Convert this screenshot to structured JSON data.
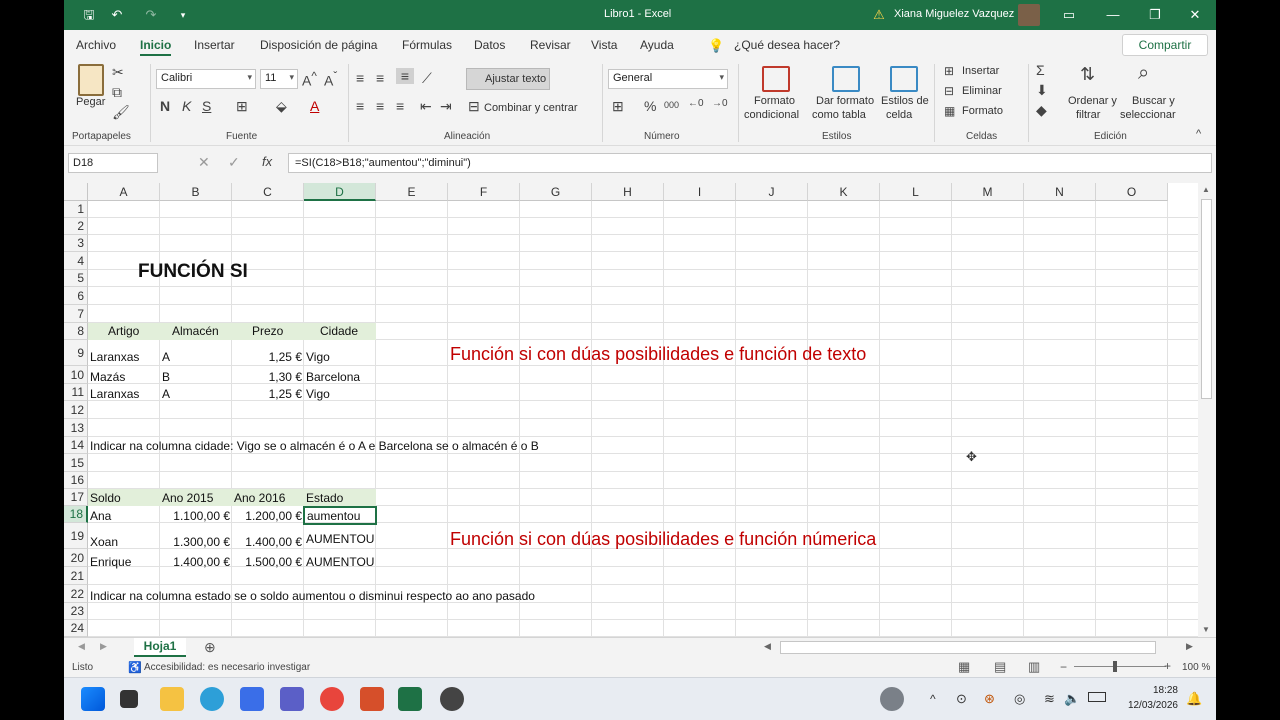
{
  "window": {
    "title": "Libro1  -  Excel",
    "user": "Xiana Miguelez Vazquez"
  },
  "tabs": [
    "Archivo",
    "Inicio",
    "Insertar",
    "Disposición de página",
    "Fórmulas",
    "Datos",
    "Revisar",
    "Vista",
    "Ayuda"
  ],
  "tell_me": "¿Qué desea hacer?",
  "share": "Compartir",
  "ribbon": {
    "paste": "Pegar",
    "clipboard": "Portapapeles",
    "font_name": "Calibri",
    "font_size": "11",
    "font": "Fuente",
    "bold": "N",
    "italic": "K",
    "underline": "S",
    "wrap": "Ajustar texto",
    "merge": "Combinar y centrar",
    "alignment": "Alineación",
    "number_format": "General",
    "number": "Número",
    "cond_format_1": "Formato",
    "cond_format_2": "condicional",
    "table_format_1": "Dar formato",
    "table_format_2": "como tabla",
    "cell_styles_1": "Estilos de",
    "cell_styles_2": "celda",
    "styles": "Estilos",
    "insert": "Insertar",
    "delete": "Eliminar",
    "format": "Formato",
    "cells": "Celdas",
    "sort_1": "Ordenar y",
    "sort_2": "filtrar",
    "find_1": "Buscar y",
    "find_2": "seleccionar",
    "editing": "Edición"
  },
  "formula_bar": {
    "name_box": "D18",
    "formula": "=SI(C18>B18;\"aumentou\";\"diminui\")",
    "fx": "fx"
  },
  "columns": [
    "A",
    "B",
    "C",
    "D",
    "E",
    "F",
    "G",
    "H",
    "I",
    "J",
    "K",
    "L",
    "M",
    "N",
    "O"
  ],
  "rows": [
    "1",
    "2",
    "3",
    "4",
    "5",
    "6",
    "7",
    "8",
    "9",
    "10",
    "11",
    "12",
    "13",
    "14",
    "15",
    "16",
    "17",
    "18",
    "19",
    "20",
    "21",
    "22",
    "23",
    "24"
  ],
  "cells": {
    "title": "FUNCIÓN SI",
    "h8": [
      "Artigo",
      "Almacén",
      "Prezo",
      "Cidade"
    ],
    "r9": [
      "Laranxas",
      "A",
      "1,25 €",
      "Vigo"
    ],
    "r10": [
      "Mazás",
      "B",
      "1,30 €",
      "Barcelona"
    ],
    "r11": [
      "Laranxas",
      "A",
      "1,25 €",
      "Vigo"
    ],
    "r14": "Indicar na columna cidade: Vigo se o almacén é o A e Barcelona se o almacén é o B",
    "h17": [
      "Soldo",
      "Ano 2015",
      "Ano 2016",
      "Estado"
    ],
    "r18": [
      "Ana",
      "1.100,00 €",
      "1.200,00 €",
      "aumentou"
    ],
    "r19": [
      "Xoan",
      "1.300,00 €",
      "1.400,00 €",
      "AUMENTOU"
    ],
    "r20": [
      "Enrique",
      "1.400,00 €",
      "1.500,00 €",
      "AUMENTOU"
    ],
    "r22": "Indicar na columna estado se o soldo aumentou o disminui respecto ao ano pasado",
    "note1": "Función si con dúas posibilidades e función de texto",
    "note2": "Función si con dúas posibilidades e función númerica"
  },
  "colors": {
    "accent": "#1e7145",
    "header_fill": "#e2efda",
    "note": "#c00000"
  },
  "sheet": {
    "name": "Hoja1"
  },
  "status": {
    "ready": "Listo",
    "accessibility": "Accesibilidad: es necesario investigar",
    "zoom": "100 %"
  },
  "clock": {
    "time": "18:28",
    "date": "12/03/2026"
  }
}
